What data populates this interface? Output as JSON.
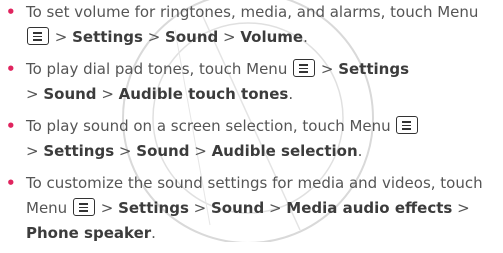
{
  "items": [
    {
      "t1": "To set volume for ringtones, media, and alarms, touch Menu ",
      "icon": "menu-key-icon",
      "sep1": " > ",
      "b1": "Settings",
      "sep2": " > ",
      "b2": "Sound",
      "sep3": " > ",
      "b3": "Volume",
      "end": "."
    },
    {
      "t1": "To play dial pad tones, touch Menu ",
      "icon": "menu-key-icon",
      "sep1": " > ",
      "b1": "Settings",
      "sep2": " > ",
      "b2": "Sound",
      "sep3": " > ",
      "b3": "Audible touch tones",
      "end": "."
    },
    {
      "t1": "To play sound on a screen selection, touch Menu ",
      "icon": "menu-key-icon",
      "sep1": " > ",
      "b1": "Settings",
      "sep2": " > ",
      "b2": "Sound",
      "sep3": " > ",
      "b3": "Audible selection",
      "end": "."
    },
    {
      "t1": "To customize the sound settings for media and videos, touch Menu ",
      "icon": "menu-key-icon",
      "sep1": " > ",
      "b1": "Settings",
      "sep2": " > ",
      "b2": "Sound",
      "sep3": " > ",
      "b3": "Media audio effects",
      "sep4": " > ",
      "b4": "Phone speaker",
      "end": "."
    }
  ],
  "colors": {
    "bullet": "#e0245e",
    "text": "#555555",
    "watermark": "#c8c8c8"
  }
}
